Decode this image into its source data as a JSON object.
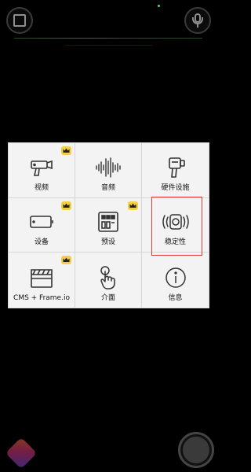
{
  "top_controls": {
    "left_icon": "square-icon",
    "right_icon": "mic-icon"
  },
  "menu": {
    "items": [
      {
        "label": "视频",
        "icon": "video-camera-icon",
        "premium": true
      },
      {
        "label": "音频",
        "icon": "audio-waveform-icon",
        "premium": false
      },
      {
        "label": "硬件设施",
        "icon": "hardware-camera-icon",
        "premium": false
      },
      {
        "label": "设备",
        "icon": "device-icon",
        "premium": true
      },
      {
        "label": "预设",
        "icon": "preset-icon",
        "premium": true
      },
      {
        "label": "稳定性",
        "icon": "stabilization-icon",
        "premium": false,
        "highlighted": true
      },
      {
        "label": "CMS + Frame.io",
        "icon": "clapperboard-icon",
        "premium": true
      },
      {
        "label": "介面",
        "icon": "touch-hand-icon",
        "premium": false
      },
      {
        "label": "信息",
        "icon": "info-icon",
        "premium": false
      }
    ]
  },
  "colors": {
    "background": "#000000",
    "panel": "#f3f3f3",
    "badge": "#f3cf48",
    "highlight": "#e53935"
  }
}
